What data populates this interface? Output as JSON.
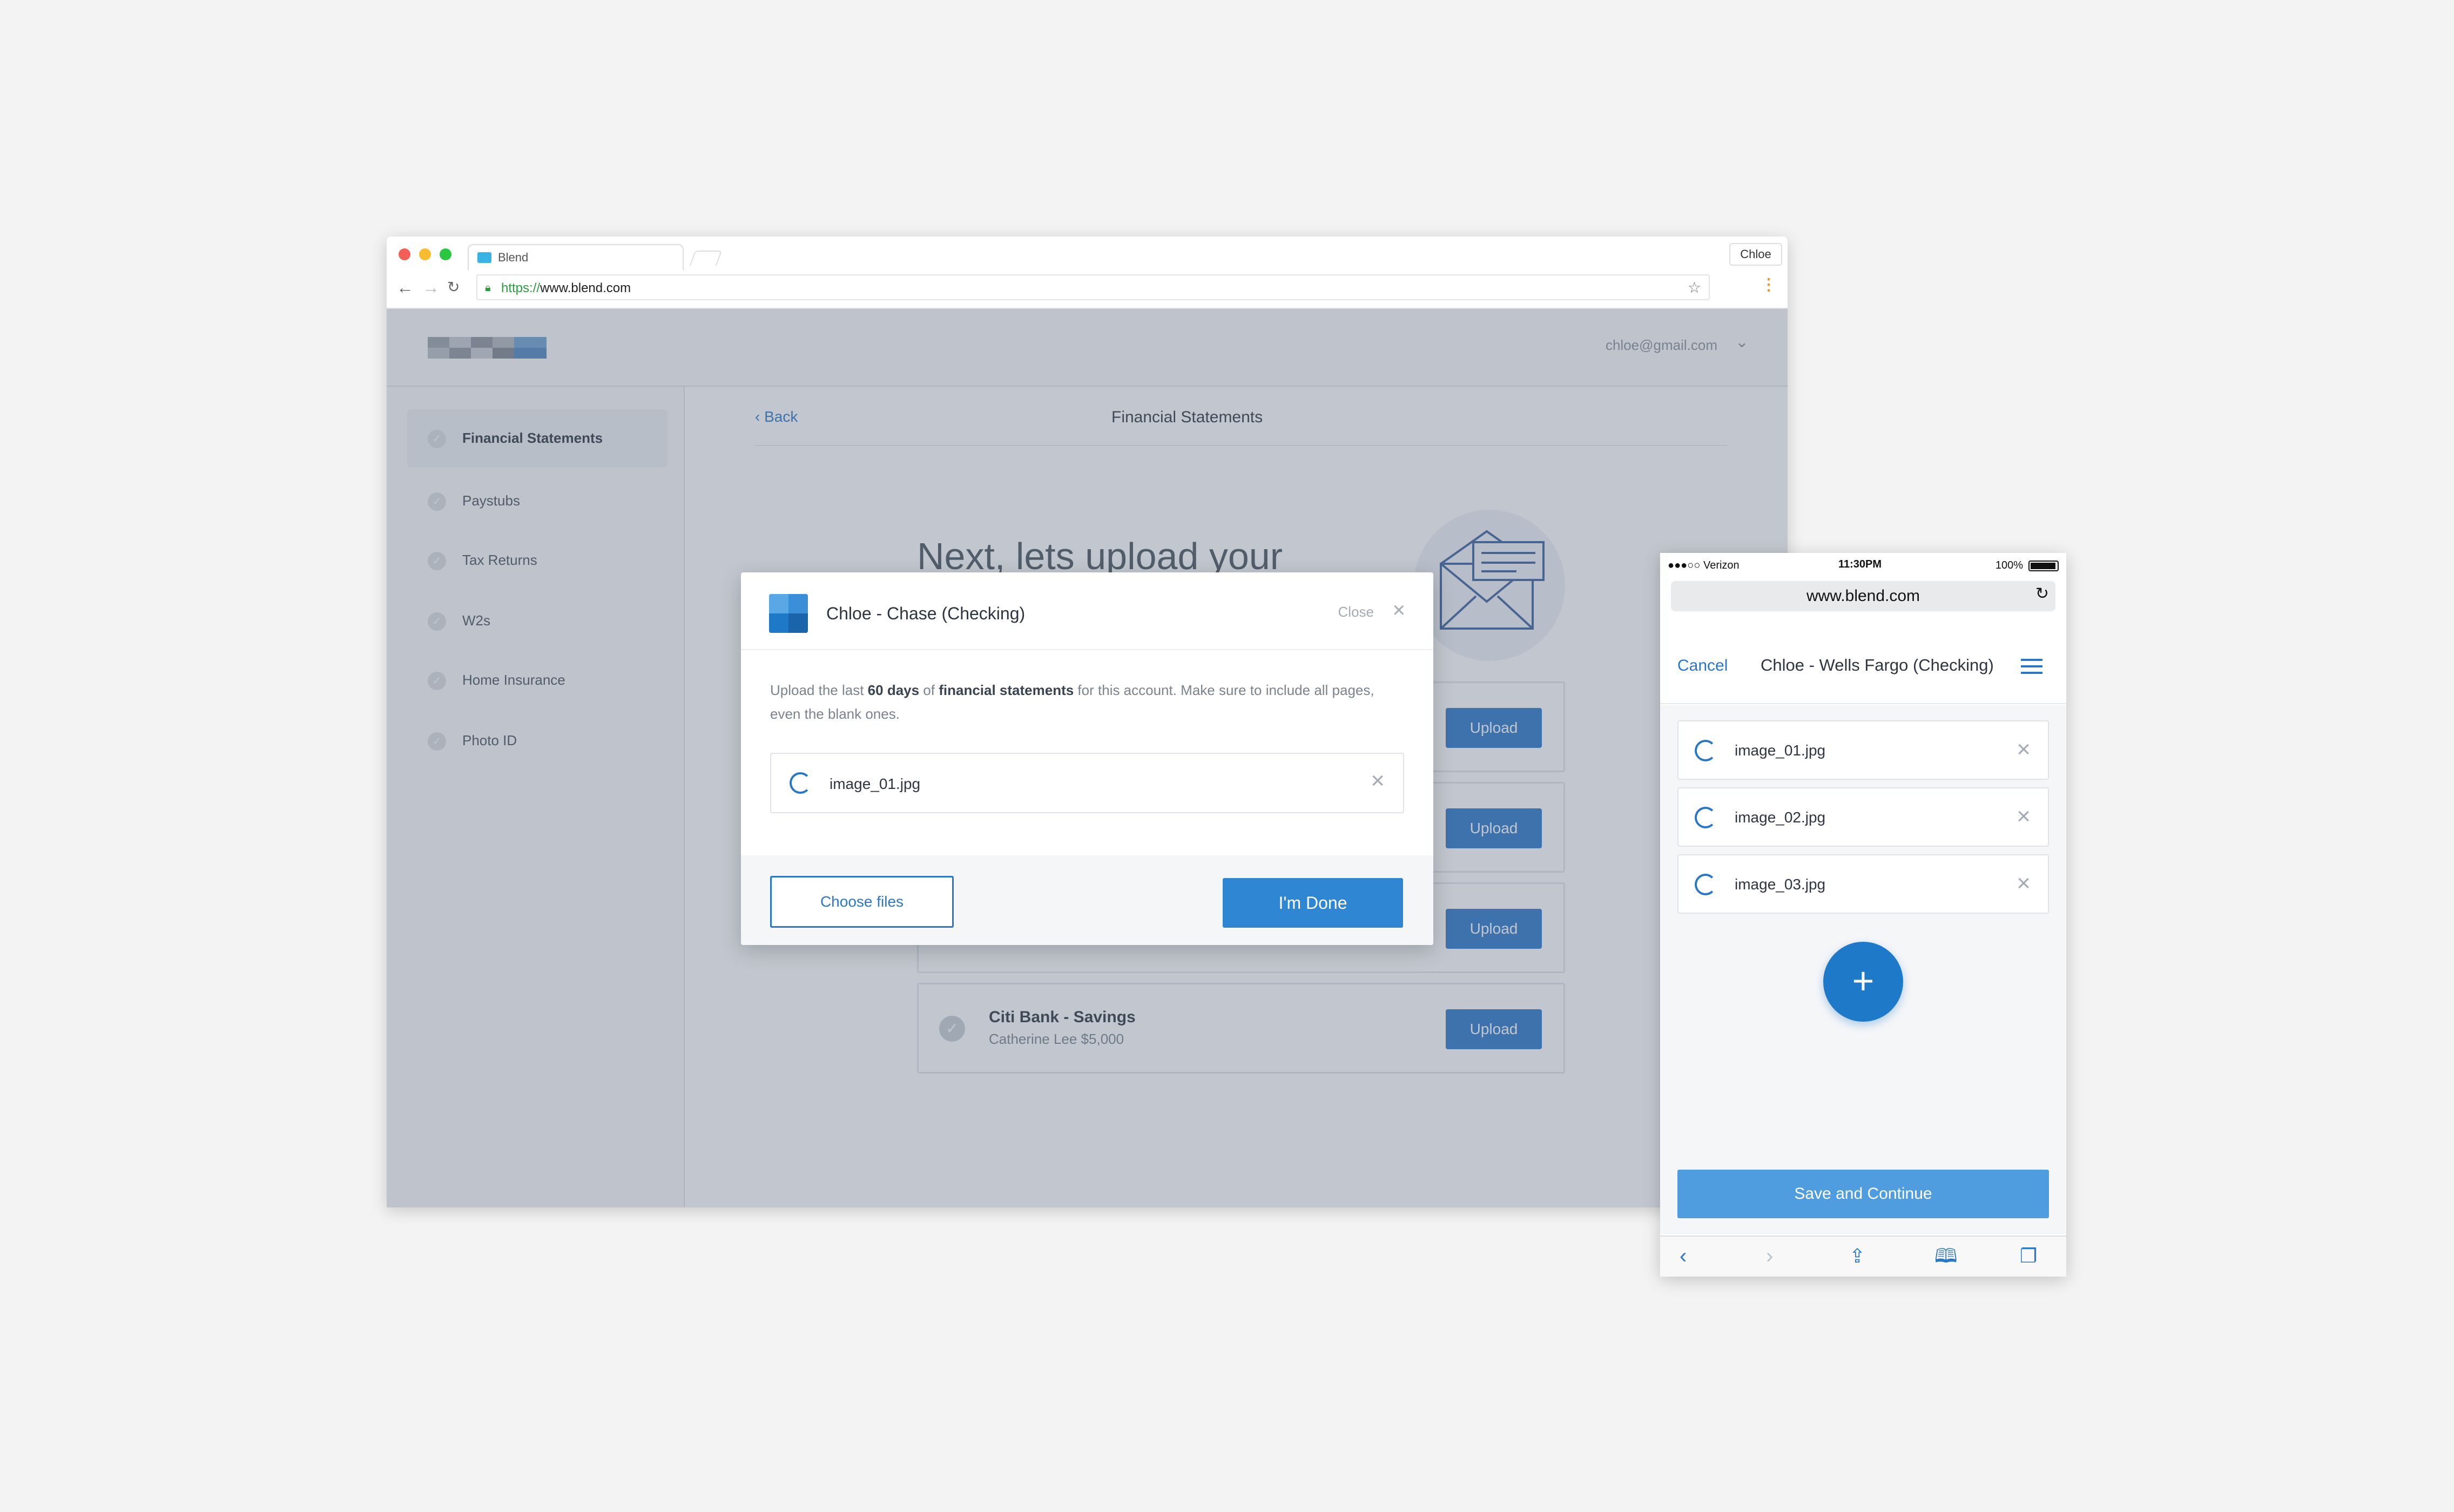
{
  "browser": {
    "tab_title": "Blend",
    "profile_name": "Chloe",
    "url_scheme": "https://",
    "url_host": "www.blend.com"
  },
  "app": {
    "user_email": "chloe@gmail.com",
    "sidebar": {
      "items": [
        {
          "label": "Financial Statements",
          "active": true
        },
        {
          "label": "Paystubs"
        },
        {
          "label": "Tax Returns"
        },
        {
          "label": "W2s"
        },
        {
          "label": "Home Insurance"
        },
        {
          "label": "Photo ID"
        }
      ]
    },
    "main": {
      "back_label": "Back",
      "page_title": "Financial Statements",
      "heading": "Next, lets upload your",
      "accounts": [
        {
          "upload_label": "Upload"
        },
        {
          "upload_label": "Upload"
        },
        {
          "upload_label": "Upload"
        },
        {
          "name": "Citi Bank - Savings",
          "subtitle": "Catherine Lee $5,000",
          "upload_label": "Upload"
        }
      ]
    }
  },
  "modal": {
    "title": "Chloe - Chase (Checking)",
    "close_label": "Close",
    "desc_1": "Upload the last ",
    "desc_bold_1": "60 days",
    "desc_2": " of ",
    "desc_bold_2": "financial statements",
    "desc_3": " for this account. Make sure to include all pages, even the blank ones.",
    "file_name": "image_01.jpg",
    "choose_label": "Choose files",
    "done_label": "I'm Done"
  },
  "phone": {
    "carrier": "●●●○○ Verizon",
    "time": "11:30PM",
    "battery": "100%",
    "url": "www.blend.com",
    "cancel_label": "Cancel",
    "title": "Chloe - Wells Fargo (Checking)",
    "files": [
      "image_01.jpg",
      "image_02.jpg",
      "image_03.jpg"
    ],
    "add_label": "+",
    "save_label": "Save and Continue"
  },
  "colors": {
    "accent": "#2a77c8",
    "bank": "#1f79c9",
    "background": "#f3f3f3"
  }
}
